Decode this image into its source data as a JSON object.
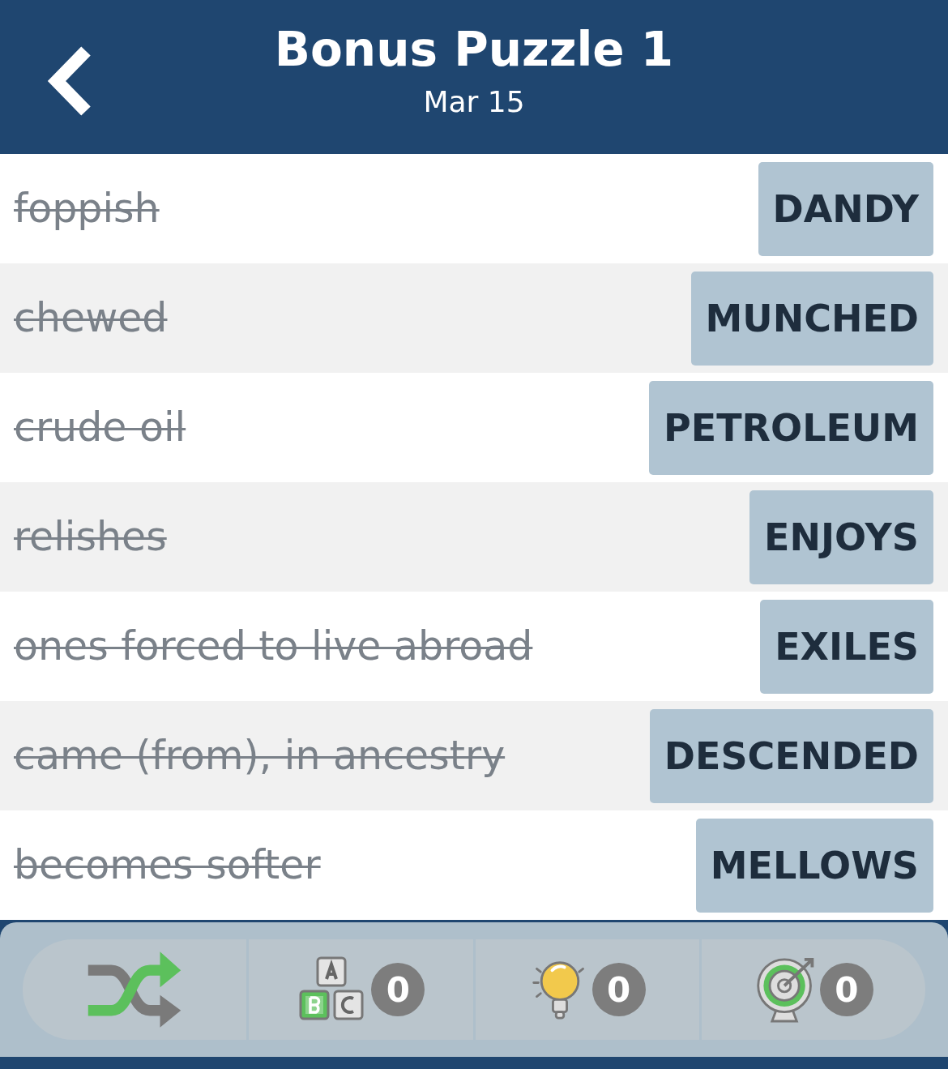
{
  "header": {
    "title": "Bonus Puzzle 1",
    "subtitle": "Mar 15"
  },
  "rows": [
    {
      "clue": "foppish",
      "answer": "DANDY",
      "solved": true
    },
    {
      "clue": "chewed",
      "answer": "MUNCHED",
      "solved": true
    },
    {
      "clue": "crude oil",
      "answer": "PETROLEUM",
      "solved": true
    },
    {
      "clue": "relishes",
      "answer": "ENJOYS",
      "solved": true
    },
    {
      "clue": "ones forced to live abroad",
      "answer": "EXILES",
      "solved": true
    },
    {
      "clue": "came (from), in ancestry",
      "answer": "DESCENDED",
      "solved": true
    },
    {
      "clue": "becomes softer",
      "answer": "MELLOWS",
      "solved": true
    }
  ],
  "toolbar": [
    {
      "kind": "shuffle"
    },
    {
      "kind": "letters",
      "count": "0"
    },
    {
      "kind": "hint",
      "count": "0"
    },
    {
      "kind": "target",
      "count": "0"
    }
  ]
}
